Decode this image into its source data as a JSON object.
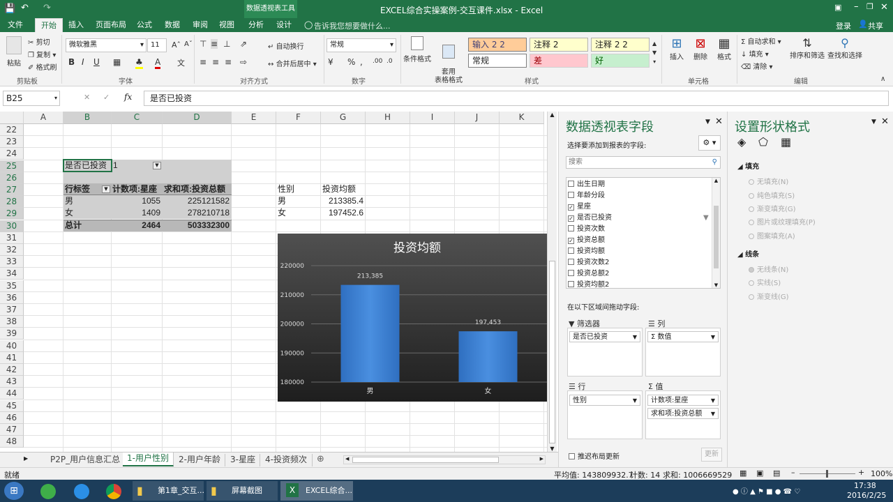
{
  "window": {
    "title": "EXCEL综合实操案例-交互课件.xlsx - Excel",
    "context_tab": "数据透视表工具"
  },
  "tabs": [
    "文件",
    "开始",
    "插入",
    "页面布局",
    "公式",
    "数据",
    "审阅",
    "视图",
    "分析",
    "设计"
  ],
  "tell_me": "告诉我您想要做什么...",
  "account": {
    "login": "登录",
    "share": "共享"
  },
  "ribbon": {
    "clipboard": {
      "paste": "粘贴",
      "cut": "剪切",
      "copy": "复制",
      "painter": "格式刷",
      "label": "剪贴板"
    },
    "font": {
      "name": "微软雅黑",
      "size": "11",
      "label": "字体"
    },
    "align": {
      "wrap": "自动换行",
      "merge": "合并后居中",
      "label": "对齐方式"
    },
    "number": {
      "format": "常规",
      "label": "数字"
    },
    "styles": {
      "cond": "条件格式",
      "table": "套用\n表格格式",
      "cells": [
        "输入 2 2",
        "注释 2",
        "注释 2 2",
        "常规",
        "差",
        "好"
      ],
      "label": "样式"
    },
    "cells": {
      "insert": "插入",
      "delete": "删除",
      "format": "格式",
      "label": "单元格"
    },
    "editing": {
      "autosum": "自动求和",
      "fill": "填充",
      "clear": "清除",
      "sort": "排序和筛选",
      "find": "查找和选择",
      "label": "编辑"
    }
  },
  "formula": {
    "namebox": "B25",
    "fx": "fx",
    "value": "是否已投资"
  },
  "columns": [
    "A",
    "B",
    "C",
    "D",
    "E",
    "F",
    "G",
    "H",
    "I",
    "J",
    "K"
  ],
  "rows": [
    "22",
    "23",
    "24",
    "25",
    "26",
    "27",
    "28",
    "29",
    "30",
    "31",
    "32",
    "33",
    "34",
    "35",
    "36",
    "37",
    "38",
    "39",
    "40",
    "41",
    "42",
    "43",
    "44",
    "45",
    "46",
    "47",
    "48"
  ],
  "pivot": {
    "filter_label": "是否已投资",
    "filter_value": "1",
    "headers": [
      "行标签",
      "计数项:星座",
      "求和项:投资总额"
    ],
    "rows": [
      [
        "男",
        "1055",
        "225121582"
      ],
      [
        "女",
        "1409",
        "278210718"
      ]
    ],
    "total": [
      "总计",
      "2464",
      "503332300"
    ]
  },
  "side_table": {
    "headers": [
      "性别",
      "投资均额"
    ],
    "rows": [
      [
        "男",
        "213385.4"
      ],
      [
        "女",
        "197452.6"
      ]
    ]
  },
  "chart_data": {
    "type": "bar",
    "title": "投资均额",
    "categories": [
      "男",
      "女"
    ],
    "values": [
      213385.4,
      197452.6
    ],
    "data_labels": [
      "213,385",
      "197,453"
    ],
    "ylim": [
      180000,
      220000
    ],
    "yticks": [
      "180000",
      "190000",
      "200000",
      "210000",
      "220000"
    ],
    "grid": true,
    "legend": "none",
    "colors": {
      "bar": "#3b7fd4",
      "background": "#2e2e2e",
      "text": "#ffffff"
    }
  },
  "sheet_tabs": [
    "P2P_用户信息汇总",
    "1-用户性别",
    "2-用户年龄",
    "3-星座",
    "4-投资频次"
  ],
  "status": {
    "ready": "就绪",
    "avg": "平均值: 143809932.7",
    "count": "计数: 14",
    "sum": "求和: 1006669529",
    "zoom": "100%"
  },
  "pivot_pane": {
    "title": "数据透视表字段",
    "subtitle": "选择要添加到报表的字段:",
    "search": "搜索",
    "fields": [
      {
        "name": "出生日期",
        "checked": false
      },
      {
        "name": "年龄分段",
        "checked": false
      },
      {
        "name": "星座",
        "checked": true
      },
      {
        "name": "是否已投资",
        "checked": true
      },
      {
        "name": "投资次数",
        "checked": false
      },
      {
        "name": "投资总额",
        "checked": true
      },
      {
        "name": "投资均额",
        "checked": false
      },
      {
        "name": "投资次数2",
        "checked": false
      },
      {
        "name": "投资总额2",
        "checked": false
      },
      {
        "name": "投资均额2",
        "checked": false
      }
    ],
    "drag_hint": "在以下区域间拖动字段:",
    "filters_label": "筛选器",
    "columns_label": "列",
    "rows_label": "行",
    "values_label": "值",
    "filters": [
      "是否已投资"
    ],
    "columns": [
      "Σ 数值"
    ],
    "rows": [
      "性别"
    ],
    "values": [
      "计数项:星座",
      "求和项:投资总额"
    ],
    "defer": "推迟布局更新",
    "update": "更新"
  },
  "shape_pane": {
    "title": "设置形状格式",
    "fill_label": "填充",
    "fill_opts": [
      "无填充(N)",
      "纯色填充(S)",
      "渐变填充(G)",
      "图片或纹理填充(P)",
      "图案填充(A)"
    ],
    "line_label": "线条",
    "line_opts": [
      "无线条(N)",
      "实线(S)",
      "渐变线(G)"
    ]
  },
  "taskbar": {
    "items": [
      "第1章_交互...",
      "屏幕截图",
      "EXCEL综合..."
    ],
    "time": "17:38",
    "date": "2016/2/25"
  }
}
